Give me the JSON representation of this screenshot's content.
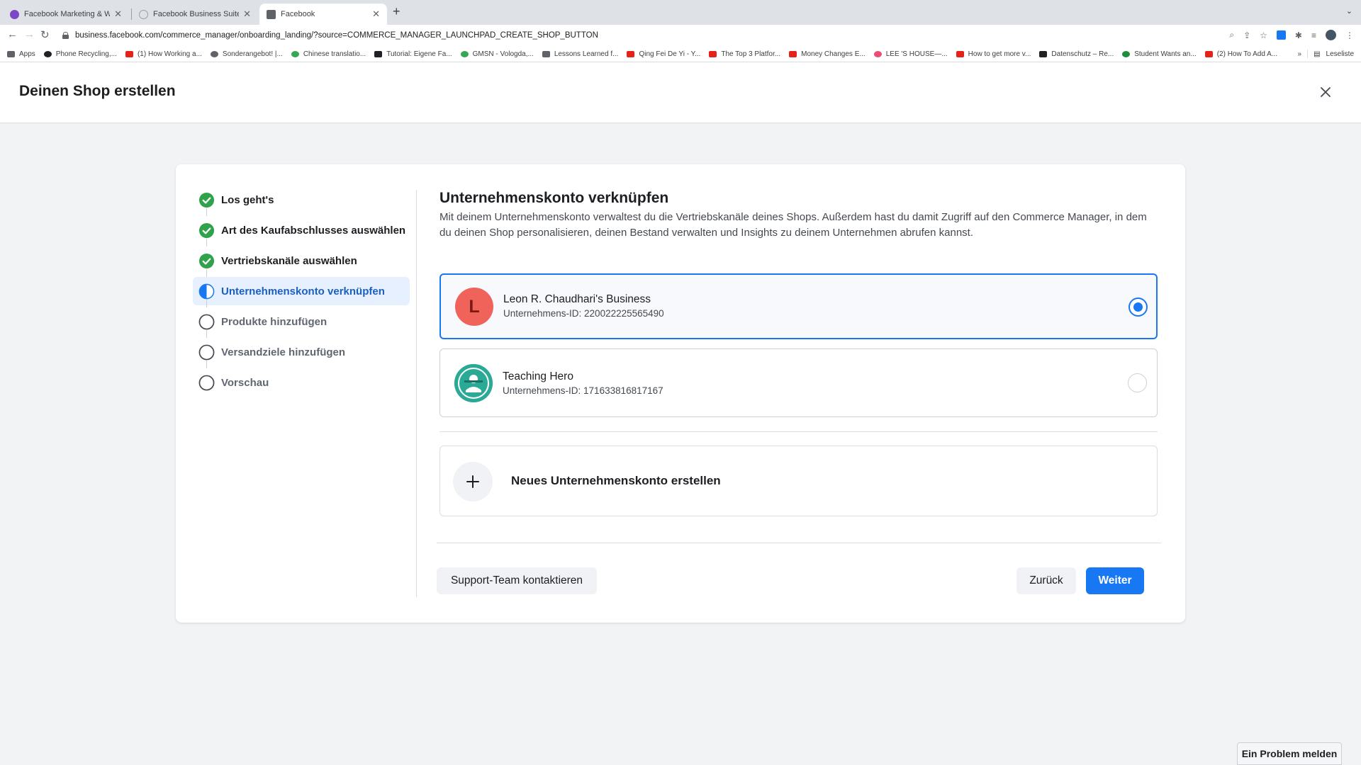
{
  "browser": {
    "tabs": [
      {
        "title": "Facebook Marketing & Werbe",
        "favicon_color": "#7b46c8"
      },
      {
        "title": "Facebook Business Suite",
        "favicon_color": "#9aa0a6"
      },
      {
        "title": "Facebook",
        "favicon_color": "#5f6368"
      }
    ],
    "url": "business.facebook.com/commerce_manager/onboarding_landing/?source=COMMERCE_MANAGER_LAUNCHPAD_CREATE_SHOP_BUTTON",
    "bookmarks": [
      {
        "label": "Apps",
        "color": "#5f6368"
      },
      {
        "label": "Phone Recycling,...",
        "color": "#202124"
      },
      {
        "label": "(1) How Working a...",
        "color": "#e62117"
      },
      {
        "label": "Sonderangebot! |...",
        "color": "#5f6368"
      },
      {
        "label": "Chinese translatio...",
        "color": "#34a853"
      },
      {
        "label": "Tutorial: Eigene Fa...",
        "color": "#202124"
      },
      {
        "label": "GMSN - Vologda,...",
        "color": "#34a853"
      },
      {
        "label": "Lessons Learned f...",
        "color": "#5f6368"
      },
      {
        "label": "Qing Fei De Yi - Y...",
        "color": "#e62117"
      },
      {
        "label": "The Top 3 Platfor...",
        "color": "#e62117"
      },
      {
        "label": "Money Changes E...",
        "color": "#e62117"
      },
      {
        "label": "LEE 'S HOUSE—...",
        "color": "#e94e77"
      },
      {
        "label": "How to get more v...",
        "color": "#e62117"
      },
      {
        "label": "Datenschutz – Re...",
        "color": "#202124"
      },
      {
        "label": "Student Wants an...",
        "color": "#1e8e3e"
      },
      {
        "label": "(2) How To Add A...",
        "color": "#e62117"
      }
    ],
    "reading_list": "Leseliste"
  },
  "header": {
    "title": "Deinen Shop erstellen"
  },
  "steps": [
    {
      "label": "Los geht's",
      "status": "done"
    },
    {
      "label": "Art des Kaufabschlusses auswählen",
      "status": "done"
    },
    {
      "label": "Vertriebskanäle auswählen",
      "status": "done"
    },
    {
      "label": "Unternehmenskonto verknüpfen",
      "status": "current"
    },
    {
      "label": "Produkte hinzufügen",
      "status": "todo"
    },
    {
      "label": "Versandziele hinzufügen",
      "status": "todo"
    },
    {
      "label": "Vorschau",
      "status": "todo"
    }
  ],
  "main": {
    "title": "Unternehmenskonto verknüpfen",
    "description": "Mit deinem Unternehmenskonto verwaltest du die Vertriebskanäle deines Shops. Außerdem hast du damit Zugriff auf den Commerce Manager, in dem du deinen Shop personalisieren, deinen Bestand verwalten und Insights zu deinem Unternehmen abrufen kannst.",
    "accounts": [
      {
        "initial": "L",
        "name": "Leon R. Chaudhari's Business",
        "id_text": "Unternehmens-ID: 220022225565490",
        "selected": true,
        "avatar_color": "#f0635a"
      },
      {
        "initial": "",
        "name": "Teaching Hero",
        "id_text": "Unternehmens-ID: 171633816817167",
        "selected": false,
        "avatar_color": "#2aaa96"
      }
    ],
    "new_account_label": "Neues Unternehmenskonto erstellen"
  },
  "footer": {
    "support_label": "Support-Team kontaktieren",
    "back_label": "Zurück",
    "next_label": "Weiter"
  },
  "report_label": "Ein Problem melden",
  "colors": {
    "accent": "#1877f2",
    "success": "#31a24c"
  }
}
